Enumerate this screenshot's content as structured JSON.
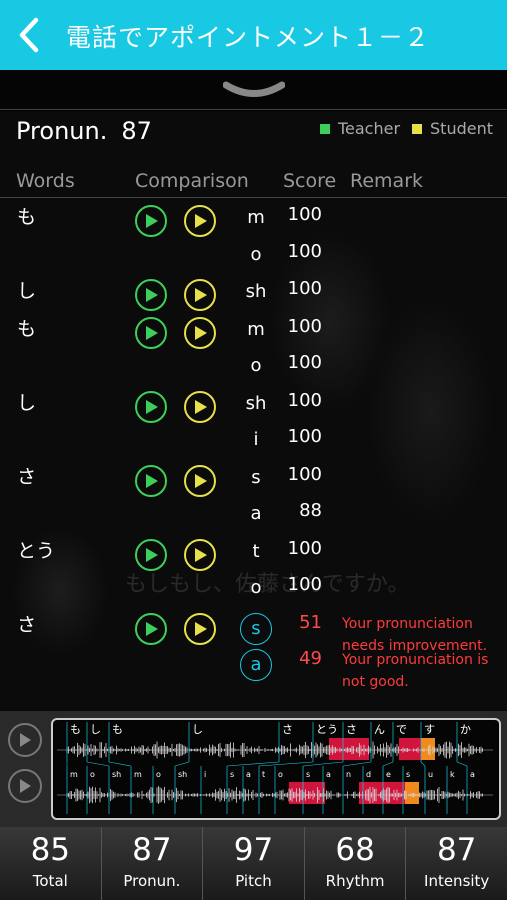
{
  "header": {
    "title": "電話でアポイントメント１－２"
  },
  "summary": {
    "pron_label": "Pronun.",
    "pron_value": "87"
  },
  "legend": {
    "teacher": "Teacher",
    "student": "Student",
    "teacher_color": "#3ecf5a",
    "student_color": "#e6e04a"
  },
  "columns": {
    "words": "Words",
    "comparison": "Comparison",
    "score": "Score",
    "remark": "Remark"
  },
  "rows": [
    {
      "word": "も",
      "phones": [
        {
          "p": "m",
          "s": "100"
        },
        {
          "p": "o",
          "s": "100"
        }
      ]
    },
    {
      "word": "し",
      "phones": [
        {
          "p": "sh",
          "s": "100"
        }
      ]
    },
    {
      "word": "も",
      "phones": [
        {
          "p": "m",
          "s": "100"
        },
        {
          "p": "o",
          "s": "100"
        }
      ]
    },
    {
      "word": "し",
      "phones": [
        {
          "p": "sh",
          "s": "100"
        },
        {
          "p": "i",
          "s": "100"
        }
      ]
    },
    {
      "word": "さ",
      "phones": [
        {
          "p": "s",
          "s": "100"
        },
        {
          "p": "a",
          "s": "88"
        }
      ]
    },
    {
      "word": "とう",
      "phones": [
        {
          "p": "t",
          "s": "100"
        },
        {
          "p": "o",
          "s": "100"
        }
      ]
    },
    {
      "word": "さ",
      "phones": [
        {
          "p": "s",
          "s": "51",
          "bad": true,
          "remark": "Your pronunciation needs improvement."
        },
        {
          "p": "a",
          "s": "49",
          "bad": true,
          "remark": "Your pronunciation is not good."
        }
      ]
    }
  ],
  "background_caption": "もしもし、佐藤さんですか。",
  "waveform": {
    "teacher_labels": [
      "も",
      "し",
      "も",
      "し",
      "さ",
      "とう",
      "さ",
      "ん",
      "で",
      "す",
      "か"
    ],
    "student_labels": [
      "m",
      "o",
      "sh",
      "m",
      "o",
      "sh",
      "i",
      "s",
      "a",
      "t",
      "o",
      "s",
      "a",
      "n",
      "d",
      "e",
      "s",
      "u",
      "k",
      "a"
    ],
    "highlight_red": "#d0143c",
    "highlight_orange": "#f08a1c"
  },
  "scores": [
    {
      "value": "85",
      "label": "Total"
    },
    {
      "value": "87",
      "label": "Pronun."
    },
    {
      "value": "97",
      "label": "Pitch"
    },
    {
      "value": "68",
      "label": "Rhythm"
    },
    {
      "value": "87",
      "label": "Intensity"
    }
  ]
}
